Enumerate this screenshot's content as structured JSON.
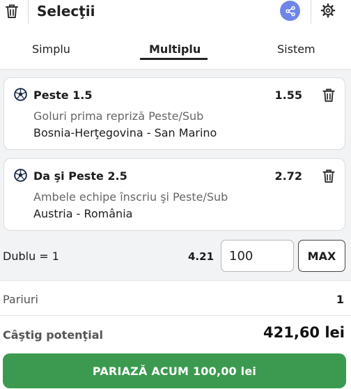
{
  "header": {
    "title": "Selecţii",
    "icons": {
      "delete_all": "trash-icon",
      "share": "share-icon",
      "settings": "gear-icon"
    },
    "share_color": "#6f86e6"
  },
  "tabs": [
    {
      "label": "Simplu",
      "active": false
    },
    {
      "label": "Multiplu",
      "active": true
    },
    {
      "label": "Sistem",
      "active": false
    }
  ],
  "selections": [
    {
      "name": "Peste 1.5",
      "odd": "1.55",
      "market": "Goluri prima repriză Peste/Sub",
      "event": "Bosnia-Herţegovina - San Marino",
      "icon": "football-icon"
    },
    {
      "name": "Da şi Peste 2.5",
      "odd": "2.72",
      "market": "Ambele echipe înscriu şi Peste/Sub",
      "event": "Austria - România",
      "icon": "football-icon"
    }
  ],
  "combo": {
    "label": "Dublu = 1",
    "odd": "4.21",
    "stake": "100",
    "max_label": "MAX"
  },
  "summary": {
    "bets_label": "Pariuri",
    "bets_value": "1",
    "win_label": "Câştig potenţial",
    "win_value": "421,60 lei"
  },
  "cta": {
    "label": "PARIAZĂ ACUM 100,00 lei",
    "color": "#3b9a4f"
  }
}
